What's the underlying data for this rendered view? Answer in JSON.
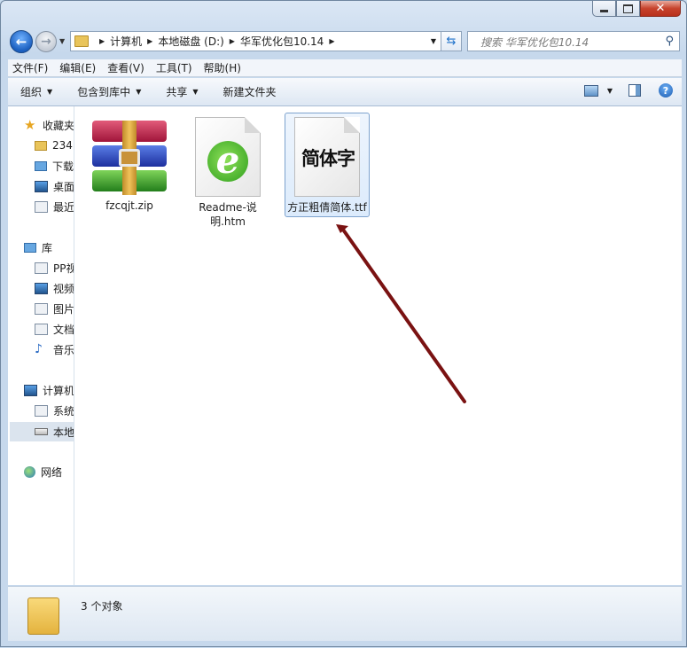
{
  "window": {
    "min_icon": "minimize-icon",
    "max_icon": "maximize-icon",
    "close_icon": "close-icon"
  },
  "address": {
    "crumbs": [
      "计算机",
      "本地磁盘 (D:)",
      "华军优化包10.14"
    ],
    "search_placeholder": "搜索 华军优化包10.14"
  },
  "menu": [
    "文件(F)",
    "编辑(E)",
    "查看(V)",
    "工具(T)",
    "帮助(H)"
  ],
  "toolbar": {
    "organize": "组织",
    "include_library": "包含到库中",
    "share": "共享",
    "new_folder": "新建文件夹"
  },
  "sidebar": {
    "favorites": "收藏夹",
    "fav_items": [
      "234",
      "下载",
      "桌面",
      "最近访问的位置"
    ],
    "libraries": "库",
    "lib_items": [
      "PP视频",
      "视频",
      "图片",
      "文档",
      "音乐"
    ],
    "computer": "计算机",
    "comp_items": [
      "系统",
      "本地磁盘 (D:)"
    ],
    "network": "网络"
  },
  "files": [
    {
      "name": "fzcqjt.zip",
      "icon": "winrar-archive-icon"
    },
    {
      "name": "Readme-说明.htm",
      "icon": "ie-html-document-icon"
    },
    {
      "name": "方正粗倩简体.ttf",
      "icon": "font-file-icon",
      "preview": "简体字"
    }
  ],
  "status": {
    "count": "3 个对象"
  },
  "colors": {
    "accent": "#7da2ce",
    "arrow": "#7a1212"
  }
}
